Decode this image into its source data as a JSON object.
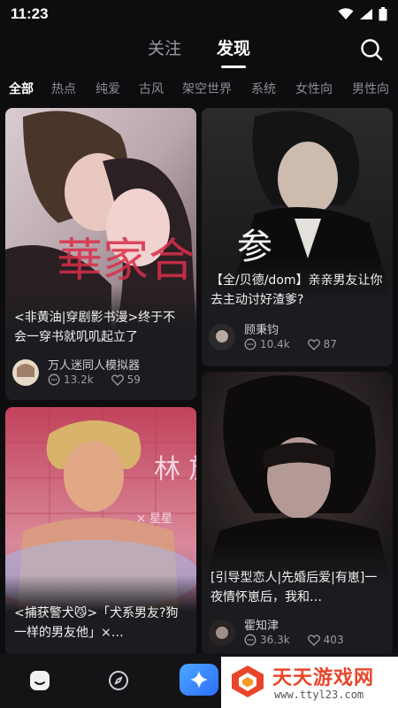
{
  "status_bar": {
    "time": "11:23"
  },
  "top_tabs": [
    {
      "label": "关注",
      "active": false
    },
    {
      "label": "发现",
      "active": true
    }
  ],
  "categories": [
    "全部",
    "热点",
    "纯爱",
    "古风",
    "架空世界",
    "系统",
    "女性向",
    "男性向"
  ],
  "cards": [
    {
      "title": "<非黄油|穿剧影书漫>终于不会一穿书就叽叽起立了",
      "cover_text": "華家合 扇",
      "author": "万人迷同人模拟器",
      "comments": "13.2k",
      "likes": "59"
    },
    {
      "title": "【全/贝德/dom】亲亲男友让你去主动讨好渣爹?",
      "cover_text": "参",
      "author": "顾秉钧",
      "comments": "10.4k",
      "likes": "87"
    },
    {
      "title": "<捕获警犬😼>「犬系男友?狗一样的男友他」×…",
      "cover_text": "林 放",
      "cover_subtext": "× 星星",
      "author": "",
      "comments": "",
      "likes": ""
    },
    {
      "title": "[引导型恋人|先婚后爱|有崽]一夜情怀崽后，我和…",
      "cover_text": "",
      "author": "霍知津",
      "comments": "36.3k",
      "likes": "403"
    }
  ],
  "bottom_nav": [
    {
      "icon": "home-icon"
    },
    {
      "icon": "compass-icon"
    },
    {
      "icon": "sparkle-icon"
    }
  ],
  "watermark": {
    "title": "天天游戏网",
    "url": "www.ttyl23.com"
  },
  "colors": {
    "background": "#0d0d0f",
    "card": "#1c1c20",
    "accent": "#2f6dff",
    "watermark": "#e8452a"
  }
}
